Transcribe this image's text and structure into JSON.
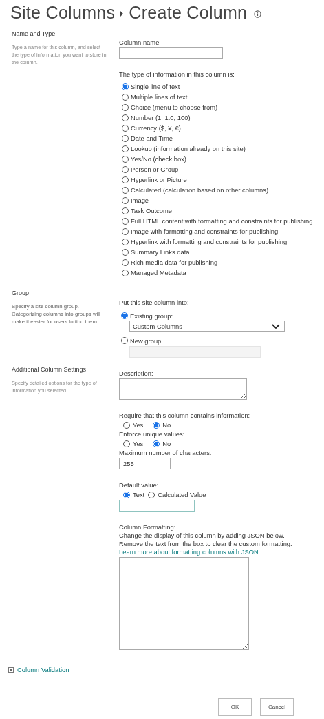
{
  "breadcrumb": {
    "parent": "Site Columns",
    "current": "Create Column"
  },
  "name_and_type": {
    "heading": "Name and Type",
    "description": "Type a name for this column, and select the type of information you want to store in the column.",
    "column_name_label": "Column name:",
    "type_label": "The type of information in this column is:",
    "types": [
      {
        "label": "Single line of text",
        "selected": true
      },
      {
        "label": "Multiple lines of text",
        "selected": false
      },
      {
        "label": "Choice (menu to choose from)",
        "selected": false
      },
      {
        "label": "Number (1, 1.0, 100)",
        "selected": false
      },
      {
        "label": "Currency ($, ¥, €)",
        "selected": false
      },
      {
        "label": "Date and Time",
        "selected": false
      },
      {
        "label": "Lookup (information already on this site)",
        "selected": false
      },
      {
        "label": "Yes/No (check box)",
        "selected": false
      },
      {
        "label": "Person or Group",
        "selected": false
      },
      {
        "label": "Hyperlink or Picture",
        "selected": false
      },
      {
        "label": "Calculated (calculation based on other columns)",
        "selected": false
      },
      {
        "label": "Image",
        "selected": false
      },
      {
        "label": "Task Outcome",
        "selected": false
      },
      {
        "label": "Full HTML content with formatting and constraints for publishing",
        "selected": false
      },
      {
        "label": "Image with formatting and constraints for publishing",
        "selected": false
      },
      {
        "label": "Hyperlink with formatting and constraints for publishing",
        "selected": false
      },
      {
        "label": "Summary Links data",
        "selected": false
      },
      {
        "label": "Rich media data for publishing",
        "selected": false
      },
      {
        "label": "Managed Metadata",
        "selected": false
      }
    ]
  },
  "group": {
    "heading": "Group",
    "description": "Specify a site column group. Categorizing columns into groups will make it easier for users to find them.",
    "label": "Put this site column into:",
    "options": [
      {
        "label": "Existing group:",
        "selected": true
      },
      {
        "label": "New group:",
        "selected": false
      }
    ],
    "existing_group_value": "Custom Columns"
  },
  "additional": {
    "heading": "Additional Column Settings",
    "description": "Specify detailed options for the type of information you selected.",
    "description_label": "Description:",
    "require_label": "Require that this column contains information:",
    "require_options": [
      {
        "label": "Yes",
        "selected": false
      },
      {
        "label": "No",
        "selected": true
      }
    ],
    "unique_label": "Enforce unique values:",
    "unique_options": [
      {
        "label": "Yes",
        "selected": false
      },
      {
        "label": "No",
        "selected": true
      }
    ],
    "max_chars_label": "Maximum number of characters:",
    "max_chars_value": "255",
    "default_label": "Default value:",
    "default_options": [
      {
        "label": "Text",
        "selected": true
      },
      {
        "label": "Calculated Value",
        "selected": false
      }
    ],
    "formatting_label": "Column Formatting:",
    "formatting_lines": [
      "Change the display of this column by adding JSON below.",
      "Remove the text from the box to clear the custom formatting."
    ],
    "formatting_link": "Learn more about formatting columns with JSON"
  },
  "column_validation": {
    "label": "Column Validation",
    "expanded": false
  },
  "buttons": [
    "OK",
    "Cancel"
  ]
}
